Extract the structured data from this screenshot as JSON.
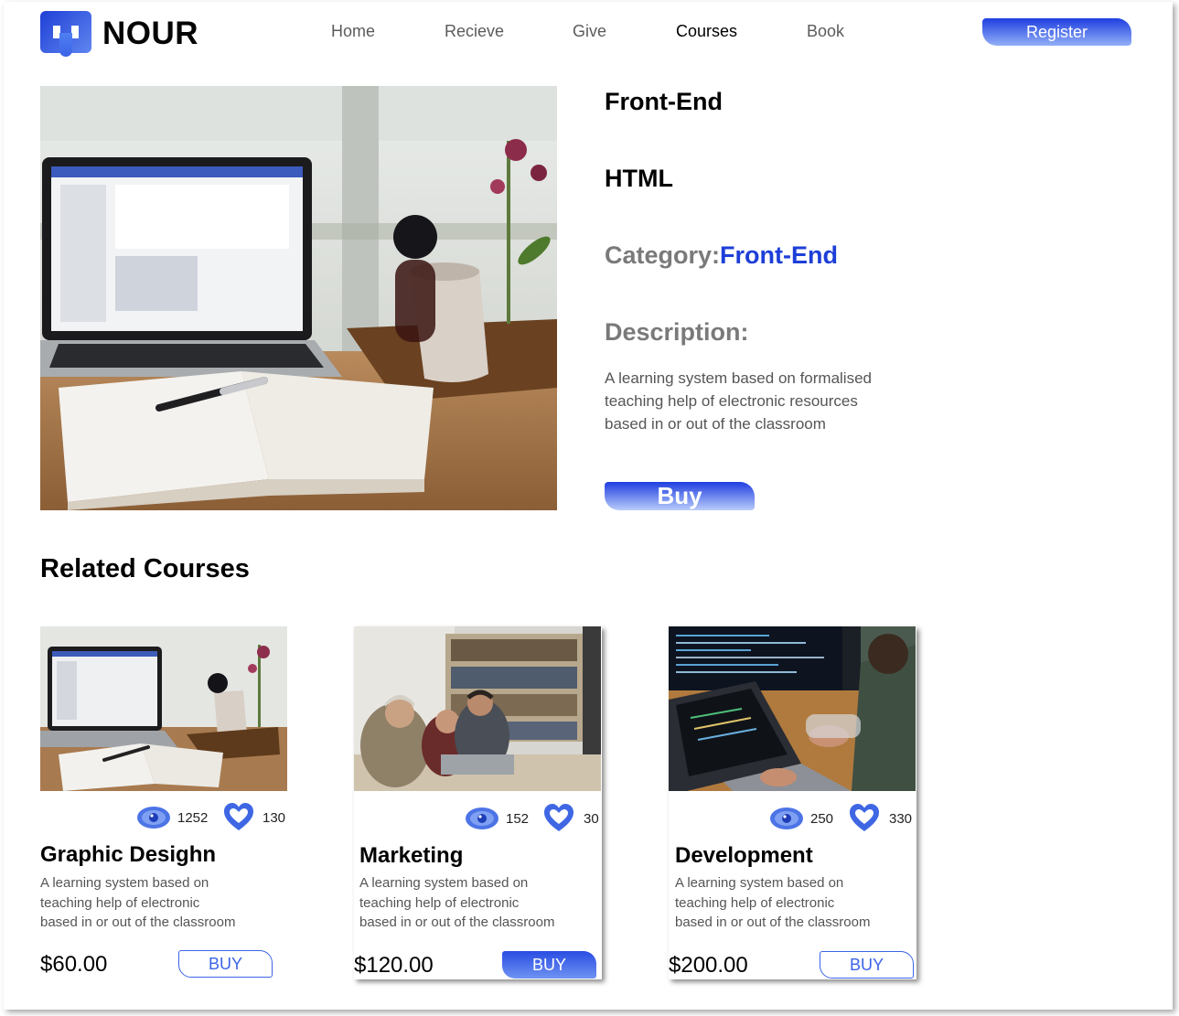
{
  "brand": {
    "name": "NOUR",
    "logo_icon": "nour-logo-icon",
    "accent": "#1d3fd8"
  },
  "nav": {
    "items": [
      {
        "label": "Home",
        "active": false
      },
      {
        "label": "Recieve",
        "active": false
      },
      {
        "label": "Give",
        "active": false
      },
      {
        "label": "Courses",
        "active": true
      },
      {
        "label": "Book",
        "active": false
      }
    ],
    "register_label": "Register"
  },
  "course": {
    "title": "Front-End",
    "subtitle": "HTML",
    "category_label": "Category:",
    "category_value": "Front-End",
    "description_heading": "Description:",
    "description_lines": [
      "A learning system based on formalised",
      "teaching help of electronic resources",
      "based in or out of the classroom"
    ],
    "buy_label": "Buy"
  },
  "related": {
    "heading": "Related Courses",
    "cards": [
      {
        "name": "Graphic Desighn",
        "views": "1252",
        "likes": "130",
        "desc_lines": [
          "A learning system based on",
          "teaching help of electronic",
          "based in or out of the classroom"
        ],
        "price": "$60.00",
        "buy_label": "BUY",
        "buy_style": "outline"
      },
      {
        "name": "Marketing",
        "views": "152",
        "likes": "30",
        "desc_lines": [
          "A learning system based on",
          "teaching help of electronic",
          "based in or out of the classroom"
        ],
        "price": "$120.00",
        "buy_label": "BUY",
        "buy_style": "filled"
      },
      {
        "name": "Development",
        "views": "250",
        "likes": "330",
        "desc_lines": [
          "A learning system based on",
          "teaching help of electronic",
          "based in or out of the classroom"
        ],
        "price": "$200.00",
        "buy_label": "BUY",
        "buy_style": "outline"
      }
    ]
  },
  "icons": {
    "views": "eye-icon",
    "likes": "heart-icon"
  }
}
